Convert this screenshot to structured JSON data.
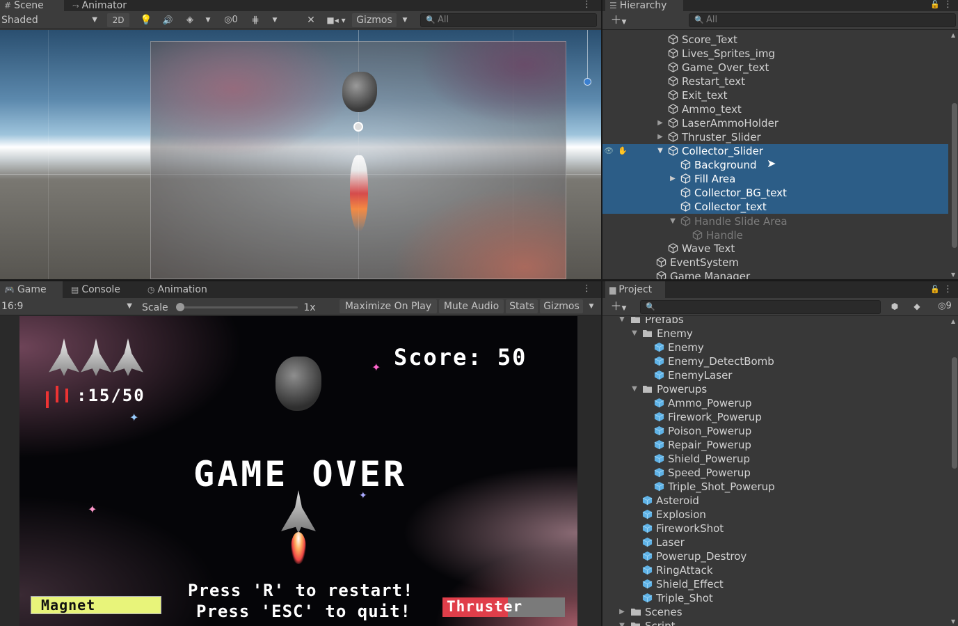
{
  "scene": {
    "tabs": [
      {
        "label": "Scene",
        "icon": "grid-icon"
      },
      {
        "label": "Animator",
        "icon": "animator-icon"
      }
    ],
    "shading_mode": "Shaded",
    "mode_2d": "2D",
    "hidden_count": "0",
    "gizmos": "Gizmos",
    "search_placeholder": "All"
  },
  "hierarchy": {
    "title": "Hierarchy",
    "search_placeholder": "All",
    "rows": [
      {
        "label": "Score_Text"
      },
      {
        "label": "Lives_Sprites_img"
      },
      {
        "label": "Game_Over_text"
      },
      {
        "label": "Restart_text"
      },
      {
        "label": "Exit_text"
      },
      {
        "label": "Ammo_text"
      },
      {
        "label": "LaserAmmoHolder"
      },
      {
        "label": "Thruster_Slider"
      },
      {
        "label": "Collector_Slider"
      },
      {
        "label": "Background"
      },
      {
        "label": "Fill Area"
      },
      {
        "label": "Collector_BG_text"
      },
      {
        "label": "Collector_text"
      },
      {
        "label": "Handle Slide Area"
      },
      {
        "label": "Handle"
      },
      {
        "label": "Wave Text"
      },
      {
        "label": "EventSystem"
      },
      {
        "label": "Game Manager"
      }
    ]
  },
  "game": {
    "tabs": [
      {
        "label": "Game"
      },
      {
        "label": "Console"
      },
      {
        "label": "Animation"
      }
    ],
    "aspect": "16:9",
    "scale_label": "Scale",
    "scale_value": "1x",
    "buttons": [
      "Maximize On Play",
      "Mute Audio",
      "Stats",
      "Gizmos"
    ],
    "hud": {
      "score": "Score: 50",
      "ammo": ":15/50",
      "game_over": "GAME OVER",
      "restart": "Press 'R' to restart!",
      "quit": "Press 'ESC' to quit!",
      "magnet": "Magnet",
      "thruster": "Thruster"
    }
  },
  "project": {
    "title": "Project",
    "hidden_count": "9",
    "rows": [
      {
        "label": "Prefabs"
      },
      {
        "label": "Enemy"
      },
      {
        "label": "Enemy"
      },
      {
        "label": "Enemy_DetectBomb"
      },
      {
        "label": "EnemyLaser"
      },
      {
        "label": "Powerups"
      },
      {
        "label": "Ammo_Powerup"
      },
      {
        "label": "Firework_Powerup"
      },
      {
        "label": "Poison_Powerup"
      },
      {
        "label": "Repair_Powerup"
      },
      {
        "label": "Shield_Powerup"
      },
      {
        "label": "Speed_Powerup"
      },
      {
        "label": "Triple_Shot_Powerup"
      },
      {
        "label": "Asteroid"
      },
      {
        "label": "Explosion"
      },
      {
        "label": "FireworkShot"
      },
      {
        "label": "Laser"
      },
      {
        "label": "Powerup_Destroy"
      },
      {
        "label": "RingAttack"
      },
      {
        "label": "Shield_Effect"
      },
      {
        "label": "Triple_Shot"
      },
      {
        "label": "Scenes"
      },
      {
        "label": "Script"
      }
    ]
  },
  "colors": {
    "selection": "#2c5d87",
    "prefab": "#5fb2e6",
    "panel": "#383838"
  }
}
